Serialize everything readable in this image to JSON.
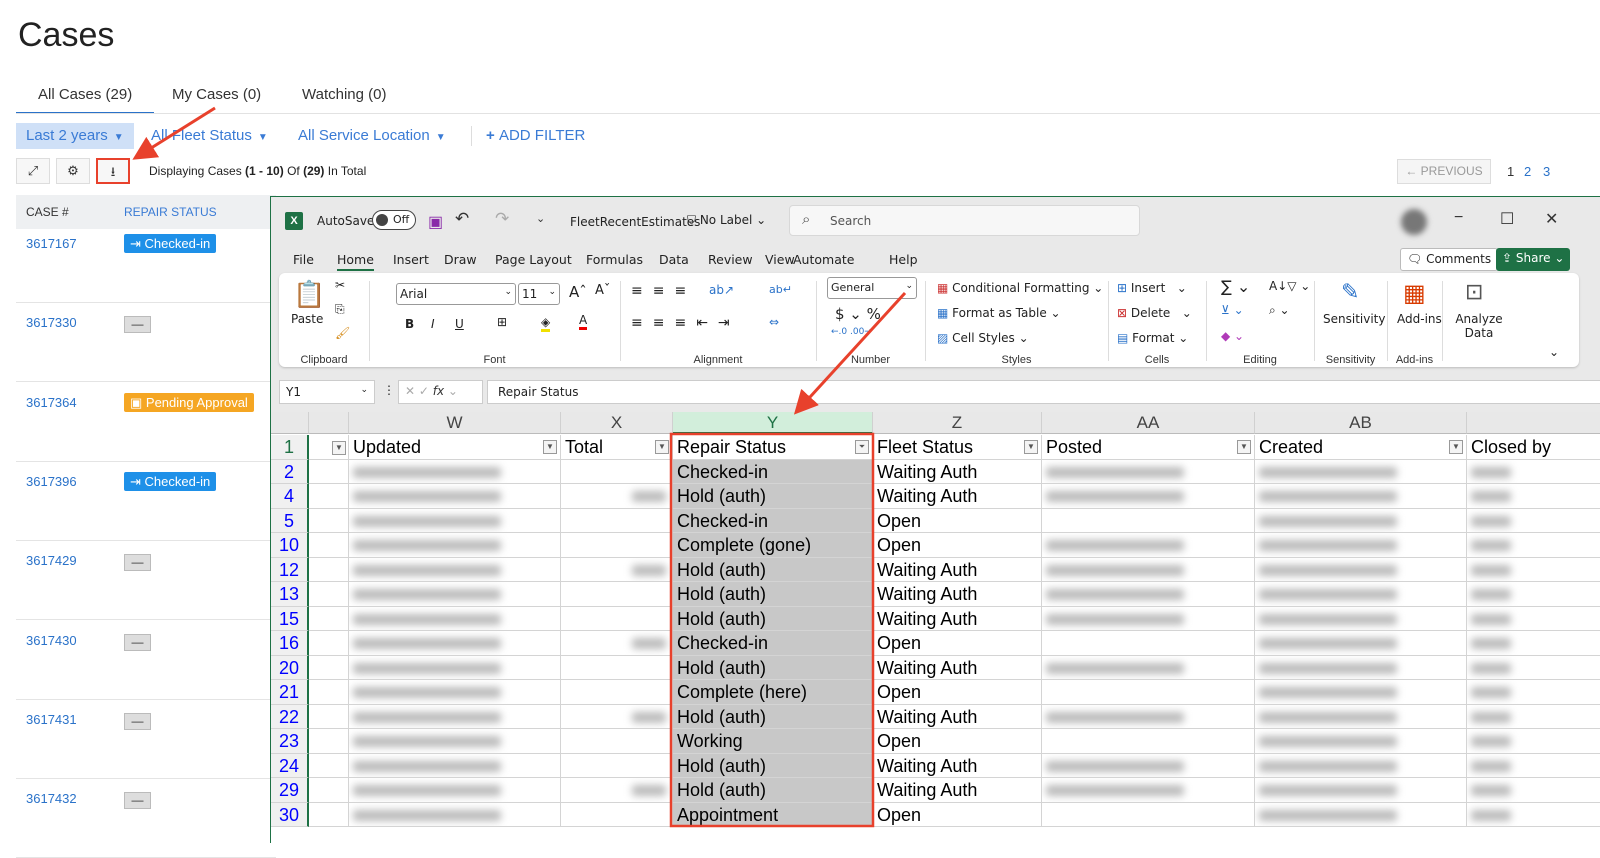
{
  "page": {
    "title": "Cases"
  },
  "tabs": [
    {
      "label": "All Cases (29)"
    },
    {
      "label": "My Cases (0)"
    },
    {
      "label": "Watching (0)"
    }
  ],
  "filters": {
    "date": "Last 2 years",
    "fleet": "All Fleet Status",
    "location": "All Service Location",
    "add": "ADD FILTER"
  },
  "display": {
    "prefix": "Displaying Cases ",
    "range": "(1 - 10)",
    "of": " Of ",
    "total": "(29)",
    "suffix": " In Total"
  },
  "pagination": {
    "previous": "← PREVIOUS",
    "pages": [
      "1",
      "2",
      "3"
    ]
  },
  "list": {
    "headers": {
      "case": "CASE #",
      "status": "REPAIR STATUS"
    },
    "rows": [
      {
        "case": "3617167",
        "status": "Checked-in"
      },
      {
        "case": "3617330",
        "status": "—"
      },
      {
        "case": "3617364",
        "status": "Pending Approval"
      },
      {
        "case": "3617396",
        "status": "Checked-in"
      },
      {
        "case": "3617429",
        "status": "—"
      },
      {
        "case": "3617430",
        "status": "—"
      },
      {
        "case": "3617431",
        "status": "—"
      },
      {
        "case": "3617432",
        "status": "—"
      }
    ]
  },
  "colors": {
    "accent": "#2a72c9",
    "checked": "#1e90e8",
    "pending": "#f5a623",
    "excel": "#1e7145",
    "annotation": "#e8412c"
  },
  "excel": {
    "autosave": "AutoSave",
    "autosave_state": "Off",
    "filename": "FleetRecentEstimates",
    "label": "No Label",
    "search": "Search",
    "menu": [
      "File",
      "Home",
      "Insert",
      "Draw",
      "Page Layout",
      "Formulas",
      "Data",
      "Review",
      "View",
      "Automate",
      "Help"
    ],
    "comments": "Comments",
    "share": "Share",
    "ribbon": {
      "paste": "Paste",
      "font": "Arial",
      "size": "11",
      "number_format": "General",
      "cond_format": "Conditional Formatting",
      "format_table": "Format as Table",
      "cell_styles": "Cell Styles",
      "insert": "Insert",
      "delete": "Delete",
      "format": "Format",
      "sensitivity": "Sensitivity",
      "addins": "Add-ins",
      "analyze": "Analyze Data",
      "groups": [
        "Clipboard",
        "Font",
        "Alignment",
        "Number",
        "Styles",
        "Cells",
        "Editing",
        "Sensitivity",
        "Add-ins"
      ]
    },
    "namebox": "Y1",
    "formula": "Repair Status",
    "columns": [
      "W",
      "X",
      "Y",
      "Z",
      "AA",
      "AB"
    ],
    "headers": [
      "Updated",
      "Total",
      "Repair Status",
      "Fleet Status",
      "Posted",
      "Created",
      "Closed by"
    ],
    "rows": [
      {
        "n": "2",
        "repair": "Checked-in",
        "fleet": "Waiting Auth"
      },
      {
        "n": "4",
        "repair": "Hold (auth)",
        "fleet": "Waiting Auth"
      },
      {
        "n": "5",
        "repair": "Checked-in",
        "fleet": "Open"
      },
      {
        "n": "10",
        "repair": "Complete (gone)",
        "fleet": "Open"
      },
      {
        "n": "12",
        "repair": "Hold (auth)",
        "fleet": "Waiting Auth"
      },
      {
        "n": "13",
        "repair": "Hold (auth)",
        "fleet": "Waiting Auth"
      },
      {
        "n": "15",
        "repair": "Hold (auth)",
        "fleet": "Waiting Auth"
      },
      {
        "n": "16",
        "repair": "Checked-in",
        "fleet": "Open"
      },
      {
        "n": "20",
        "repair": "Hold (auth)",
        "fleet": "Waiting Auth"
      },
      {
        "n": "21",
        "repair": "Complete (here)",
        "fleet": "Open"
      },
      {
        "n": "22",
        "repair": "Hold (auth)",
        "fleet": "Waiting Auth"
      },
      {
        "n": "23",
        "repair": "Working",
        "fleet": "Open"
      },
      {
        "n": "24",
        "repair": "Hold (auth)",
        "fleet": "Waiting Auth"
      },
      {
        "n": "29",
        "repair": "Hold (auth)",
        "fleet": "Waiting Auth"
      },
      {
        "n": "30",
        "repair": "Appointment",
        "fleet": "Open"
      }
    ]
  }
}
